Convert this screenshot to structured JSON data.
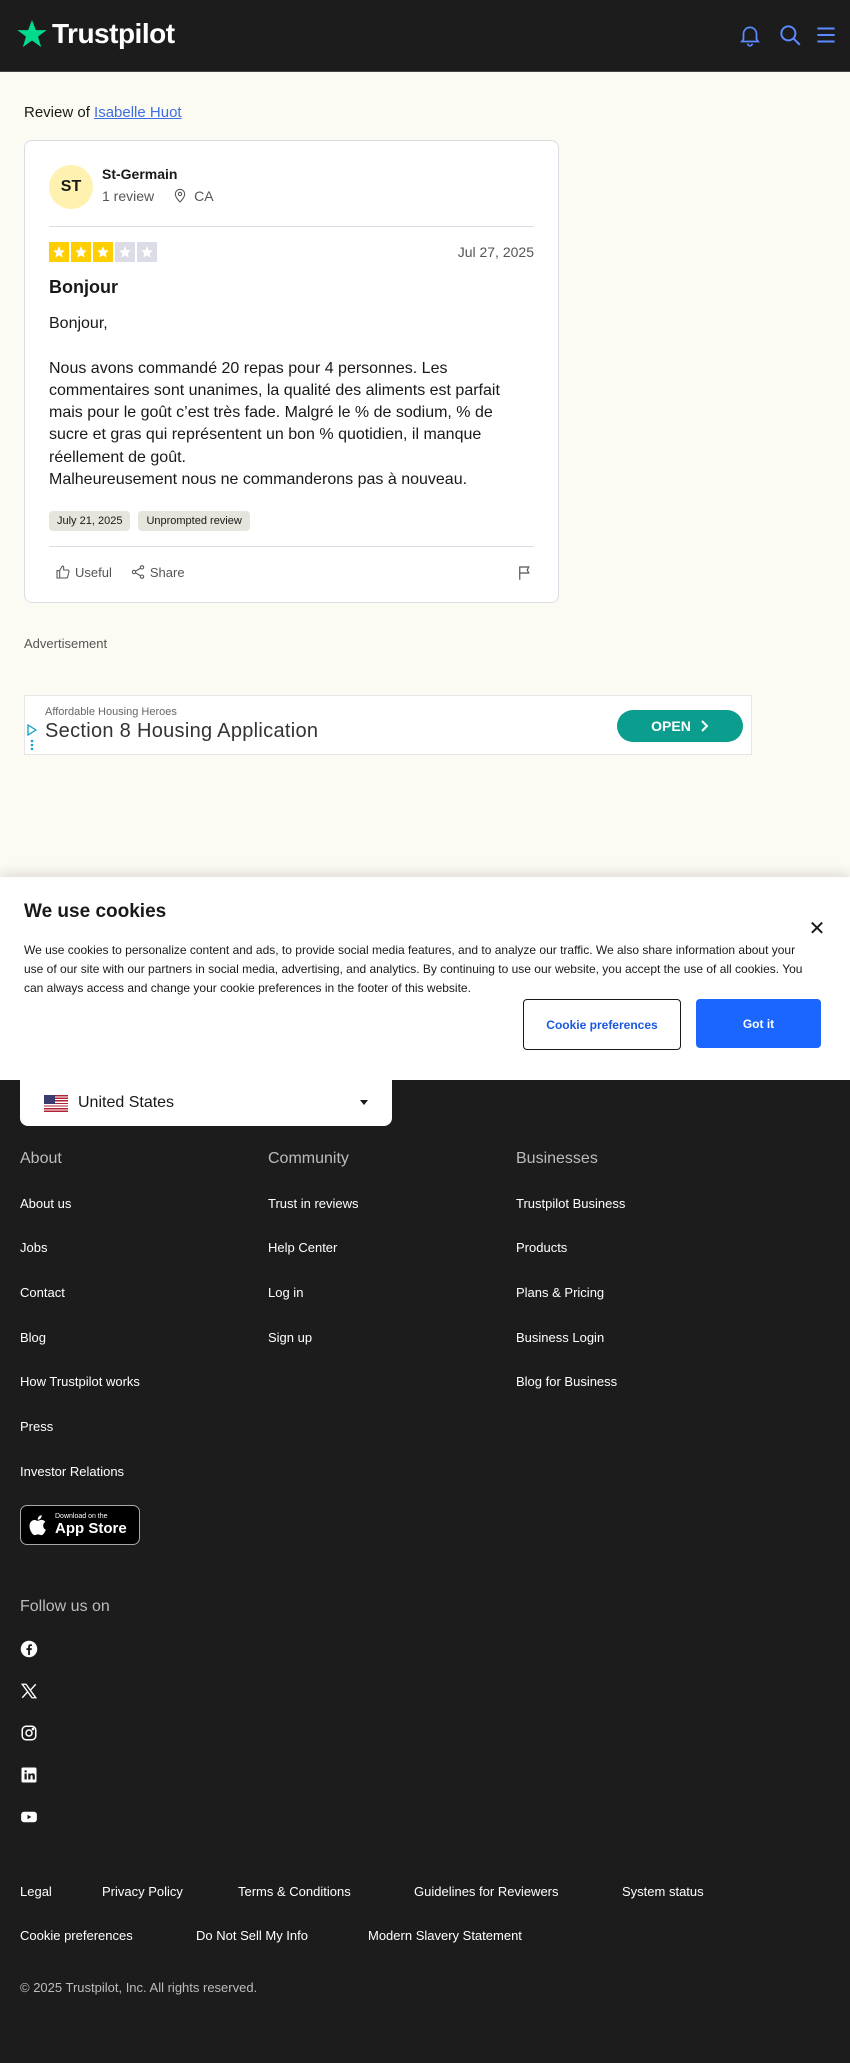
{
  "header": {
    "brand": "Trustpilot"
  },
  "review_of": {
    "prefix": "Review of",
    "business": "Isabelle Huot"
  },
  "review": {
    "avatar_initials": "ST",
    "reviewer_name": "St-Germain",
    "review_count": "1 review",
    "location": "CA",
    "rating": 3,
    "max_rating": 5,
    "date": "Jul 27, 2025",
    "title": "Bonjour",
    "body": "Bonjour,\n\nNous avons commandé 20 repas pour 4 personnes. Les commentaires sont unanimes, la qualité des aliments est parfait mais pour le goût c’est très fade. Malgré le % de sodium, % de sucre et gras qui représentent un bon % quotidien, il manque réellement de goût.\nMalheureusement nous ne commanderons pas à nouveau.",
    "tags": [
      "July 21, 2025",
      "Unprompted review"
    ],
    "useful_label": "Useful",
    "share_label": "Share"
  },
  "advertisement": {
    "label": "Advertisement",
    "brand": "Affordable Housing Heroes",
    "headline": "Section 8 Housing Application",
    "cta": "OPEN"
  },
  "cookie_banner": {
    "title": "We use cookies",
    "text": "We use cookies to personalize content and ads, to provide social media features, and to analyze our traffic. We also share information about your use of our site with our partners in social media, advertising, and analytics. By continuing to use our website, you accept the use of all cookies. You can always access and change your cookie preferences in the footer of this website.",
    "prefs_button": "Cookie preferences",
    "accept_button": "Got it"
  },
  "footer": {
    "country": "United States",
    "columns": [
      {
        "title": "About",
        "links": [
          "About us",
          "Jobs",
          "Contact",
          "Blog",
          "How Trustpilot works",
          "Press",
          "Investor Relations"
        ]
      },
      {
        "title": "Community",
        "links": [
          "Trust in reviews",
          "Help Center",
          "Log in",
          "Sign up"
        ]
      },
      {
        "title": "Businesses",
        "links": [
          "Trustpilot Business",
          "Products",
          "Plans & Pricing",
          "Business Login",
          "Blog for Business"
        ]
      }
    ],
    "app_store": {
      "small": "Download on the",
      "big": "App Store"
    },
    "follow_title": "Follow us on",
    "social": [
      "facebook-icon",
      "x-icon",
      "instagram-icon",
      "linkedin-icon",
      "youtube-icon"
    ],
    "legal_row1": [
      "Legal",
      "Privacy Policy",
      "Terms & Conditions",
      "Guidelines for Reviewers",
      "System status"
    ],
    "legal_row2": [
      "Cookie preferences",
      "Do Not Sell My Info",
      "Modern Slavery Statement"
    ],
    "copyright": "© 2025 Trustpilot, Inc. All rights reserved."
  },
  "colors": {
    "star_on": "#ffce00",
    "brand_green": "#04da8d",
    "primary_blue": "#1a66ff",
    "ad_teal": "#0b9e8e"
  }
}
